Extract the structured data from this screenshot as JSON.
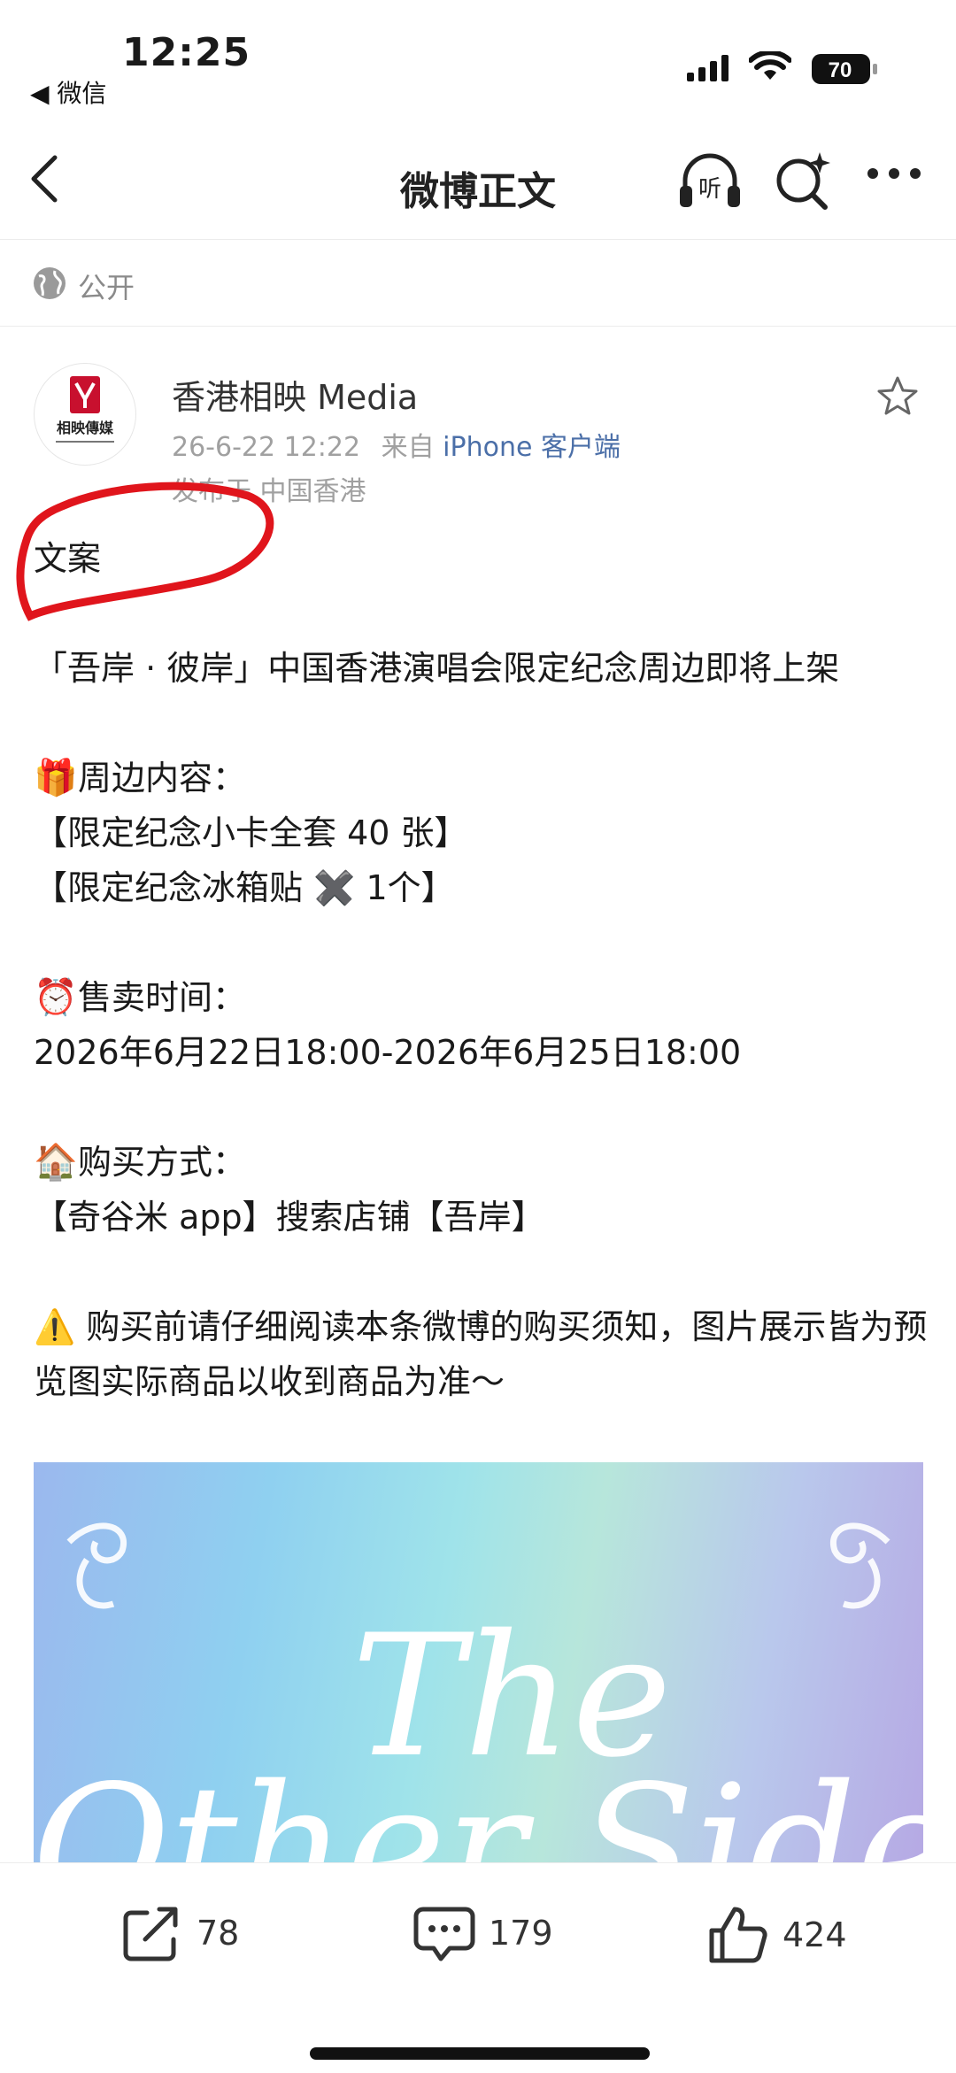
{
  "status_bar": {
    "time": "12:25",
    "back_app": "◀ 微信",
    "battery": "70"
  },
  "nav": {
    "title": "微博正文"
  },
  "visibility": {
    "label": "公开"
  },
  "post": {
    "author": "香港相映 Media",
    "date": "26-6-22 12:22",
    "source_prefix": "来自",
    "device": "iPhone 客户端",
    "location": "发布于 中国香港",
    "avatar_text": "相映傳媒",
    "lines": [
      "文案",
      "",
      "「吾岸 · 彼岸」中国香港演唱会限定纪念周边即将上架",
      "",
      "周边内容：",
      "【限定纪念小卡全套 40 张】",
      "【限定纪念冰箱贴 ✖️ 1个】",
      "",
      "售卖时间：",
      "2026年6月22日18:00-2026年6月25日18:00",
      "",
      "购买方式：",
      "【奇谷米 app】搜索店铺【吾岸】",
      "",
      "⚠️ 购买前请仔细阅读本条微博的购买须知，图片展示皆为预览图实际商品以收到商品为准～"
    ],
    "emojis": {
      "gift": "🎁",
      "clock": "⏰",
      "house": "🏠"
    },
    "poster_text": [
      "The",
      "Other Side"
    ]
  },
  "actions": {
    "share_count": "78",
    "comment_count": "179",
    "like_count": "424"
  },
  "colors": {
    "link": "#4b6fa8",
    "annotation": "#e0151c",
    "muted": "#a0a0a0"
  }
}
